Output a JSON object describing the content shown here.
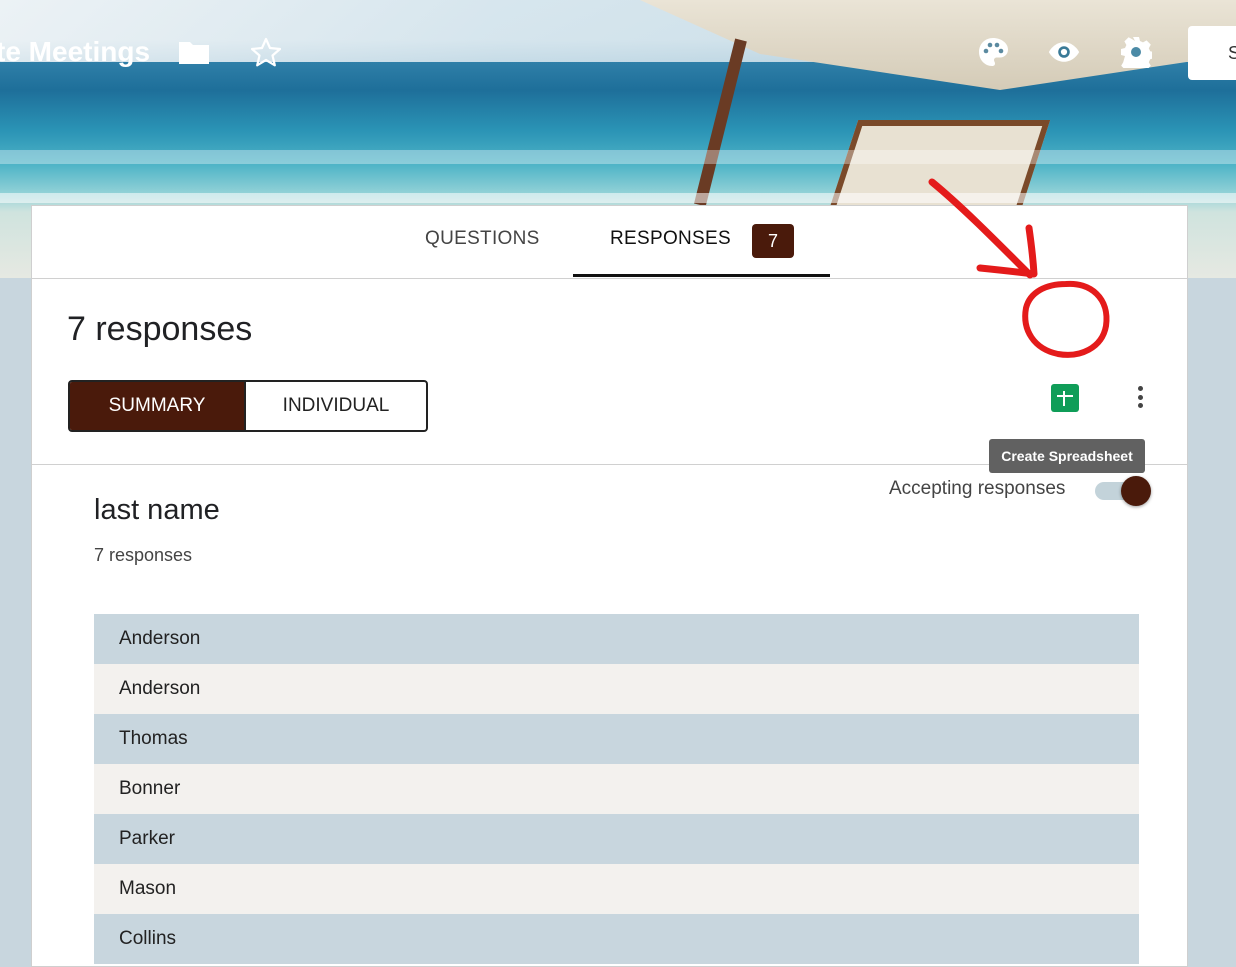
{
  "header": {
    "form_title": "te Meetings",
    "send_label": "S",
    "icons": [
      "folder-icon",
      "star-icon",
      "palette-icon",
      "eye-icon",
      "gear-icon"
    ]
  },
  "tabs": {
    "questions": "QUESTIONS",
    "responses": "RESPONSES",
    "response_count": "7"
  },
  "responses_panel": {
    "title": "7 responses",
    "summary_label": "SUMMARY",
    "individual_label": "INDIVIDUAL",
    "tooltip": "Create Spreadsheet",
    "accepting_label": "Accepting responses",
    "accepting": true
  },
  "question": {
    "title": "last name",
    "count_text": "7 responses",
    "answers": [
      "Anderson",
      "Anderson",
      "Thomas",
      "Bonner",
      "Parker",
      "Mason",
      "Collins"
    ]
  },
  "colors": {
    "accent": "#4a1a0b",
    "sheets_green": "#0f9d58",
    "annotation_red": "#e41b1b"
  }
}
